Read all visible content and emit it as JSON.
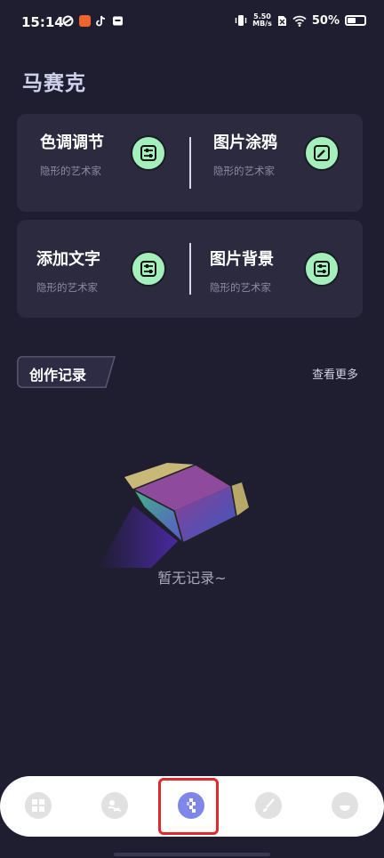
{
  "status_bar": {
    "time": "15:14",
    "speed_top": "5.50",
    "speed_bottom": "MB/s",
    "battery_pct": "50%"
  },
  "header": {
    "title": "马赛克"
  },
  "features": [
    {
      "name": "色调调节",
      "desc": "隐形的艺术家",
      "icon": "sliders-icon"
    },
    {
      "name": "图片涂鸦",
      "desc": "隐形的艺术家",
      "icon": "edit-icon"
    },
    {
      "name": "添加文字",
      "desc": "隐形的艺术家",
      "icon": "sliders-icon"
    },
    {
      "name": "图片背景",
      "desc": "隐形的艺术家",
      "icon": "sliders-icon"
    }
  ],
  "records": {
    "section_title": "创作记录",
    "more_link": "查看更多",
    "empty_text": "暂无记录~"
  },
  "tabs": [
    {
      "icon": "grid-icon",
      "selected": false
    },
    {
      "icon": "palette-icon",
      "selected": false
    },
    {
      "icon": "mosaic-icon",
      "selected": true
    },
    {
      "icon": "brush-icon",
      "selected": false
    },
    {
      "icon": "face-icon",
      "selected": false
    }
  ],
  "colors": {
    "background": "#1f1d30",
    "card": "#2b2a3e",
    "icon_badge": "#a4f0bc",
    "selected_tab": "#7e86e8",
    "highlight": "#e0292f"
  }
}
